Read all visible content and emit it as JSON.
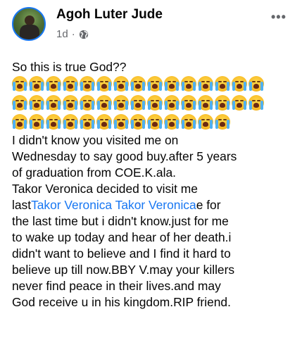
{
  "post": {
    "author": "Agoh Luter Jude",
    "time": "1d",
    "separator": "·",
    "privacy_icon": "globe-icon",
    "more_icon": "more-options-icon",
    "more_glyph": "•••"
  },
  "content": {
    "opening": "So this is true God??",
    "emoji_rows": [
      15,
      15,
      13
    ],
    "emoji_icon": "loudly-crying-face-emoji",
    "lines": [
      "I didn't know you visited me on",
      "Wednesday to say good buy.after 5 years",
      "of graduation from COE.K.ala.",
      "Takor Veronica decided to visit me"
    ],
    "mention_line": {
      "prefix": "last",
      "mention1": "Takor Veronica",
      "space": " ",
      "mention2": "Takor Veronica",
      "suffix": "e for"
    },
    "lines_after": [
      "the last time but i didn't know.just for me",
      "to wake up today and hear of her death.i",
      "didn't want to believe and I find it hard to",
      "believe up till now.BBY V.may your killers",
      "never find peace in their lives.and may",
      "God receive u in his kingdom.RIP friend."
    ]
  },
  "colors": {
    "link": "#1877f2",
    "meta": "#65676b",
    "text": "#050505"
  }
}
